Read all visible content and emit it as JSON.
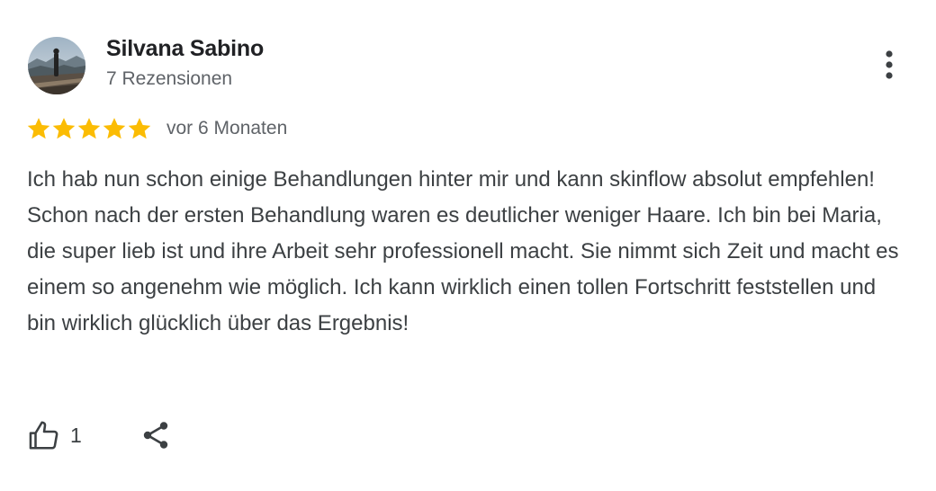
{
  "review": {
    "author": "Silvana Sabino",
    "review_count": "7 Rezensionen",
    "rating": 5,
    "rating_max": 5,
    "date": "vor 6 Monaten",
    "text": "Ich hab nun schon einige Behandlungen hinter mir und kann skinflow absolut empfehlen! Schon nach der ersten Behandlung waren es deutlicher weniger Haare. Ich bin bei Maria, die super lieb ist und ihre Arbeit sehr professionell macht. Sie nimmt sich Zeit und macht es einem so angenehm wie möglich. Ich kann wirklich einen tollen Fortschritt feststellen und bin wirklich glücklich über das Ergebnis!",
    "likes": "1"
  },
  "icons": {
    "more": "more-vert-icon",
    "like": "thumb-up-icon",
    "share": "share-icon",
    "star": "star-icon"
  },
  "colors": {
    "star": "#fbbc04",
    "name": "#202124",
    "secondary": "#5f6368",
    "body": "#3c4043"
  }
}
